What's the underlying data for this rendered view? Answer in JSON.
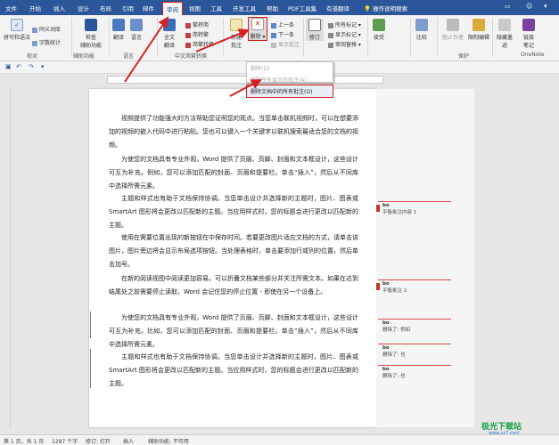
{
  "tabs": [
    "文件",
    "开始",
    "插入",
    "设计",
    "布局",
    "引用",
    "邮件",
    "审阅",
    "视图",
    "工具",
    "开发工具",
    "帮助",
    "PDF工具集",
    "有道翻译",
    "操作说明搜索"
  ],
  "ribbon": {
    "spelling": "拼写和语法",
    "thesaurus": "同义词库",
    "wordcount": "字数统计",
    "proofing": "校对",
    "check_access": "检查\n辅助功能",
    "access_grp": "辅助功能",
    "translate": "翻译",
    "language": "语言",
    "lang_grp": "语言",
    "full_translate": "全文\n翻译",
    "fanjian": "繁转简",
    "jianfan": "简转繁",
    "jianfanconv": "简繁转换",
    "chinese_grp": "中文简繁转换",
    "new_comment": "新建\n批注",
    "delete": "删除",
    "prev": "上一条",
    "next": "下一条",
    "show_comments": "显示批注",
    "track": "修订",
    "all_markup": "所有标记",
    "show_markup": "显示标记",
    "review_pane": "审阅窗格",
    "accept": "接受",
    "compare": "比较",
    "block": "阻止作者",
    "restrict": "限制编辑",
    "protect_grp": "保护",
    "hide_ink": "隐藏墨\n迹",
    "link_note": "链接\n笔记",
    "onenote_grp": "OneNote"
  },
  "dropdown": {
    "item1": "删除(D)",
    "item2": "删除所有显示的批注(A)",
    "item3": "删除文档中的所有批注(O)"
  },
  "paragraphs": [
    "视频提供了功能强大的方法帮助您证明您的观点。当您单击联机视频时，可以在想要添加的视频的嵌入代码中进行粘贴。您也可以键入一个关键字以联机搜索最适合您的文档的视频。",
    "为使您的文档具有专业外观，Word 提供了页眉、页脚、封面和文本框设计，这些设计可互为补充。例如，您可以添加匹配的封面、页眉和提要栏。单击“插入”，然后从不同库中选择所需元素。",
    "主题和样式也有助于文档保持协调。当您单击设计并选择新的主题时，图片、图表或 SmartArt 图形将会更改以匹配新的主题。当应用样式时，您的标题会进行更改以匹配新的主题。",
    "使用在需要位置出现的新按钮在中保存时间。若要更改图片适应文档的方式，请单击该图片，图片旁边将会显示布局选项按钮。当处理表格时，单击要添加行或列的位置，然后单击加号。",
    "在新的阅读视图中阅读更加容易。可以折叠文档某些部分并关注所需文本。如果在达到结尾处之前需要停止读取，Word 会记住您的停止位置 - 即使在另一个设备上。",
    "为使您的文档具有专业外观，Word 提供了页眉、页脚、封面和文本框设计，这些设计可互为补充。比如，您可以添加匹配的封面、页眉和提要栏。单击“插入”，然后从不同库中选择所需元素。",
    "主题和样式也有助于文档保持协调。当您单击设计并选择新的主题时，图片、图表或 SmartArt 图形将会更改以匹配新的主题。当应用样式时，您的标题会进行更改以匹配新的主题。"
  ],
  "comments": [
    {
      "author": "bo",
      "text": "平衡批注内容 1"
    },
    {
      "author": "bo",
      "text": "平衡批注 2"
    },
    {
      "author": "bo",
      "text": "删除了: 例如"
    },
    {
      "author": "bo",
      "text": "删除了: 也"
    },
    {
      "author": "bo",
      "text": "删除了: 也"
    }
  ],
  "status": {
    "page": "第 1 页，共 1 页",
    "words": "1287 个字",
    "track": "修订: 打开",
    "mode": "插入",
    "access": "辅助功能: 不可用"
  },
  "watermark": {
    "main": "极光下载站",
    "sub": "www.xz7.com"
  }
}
